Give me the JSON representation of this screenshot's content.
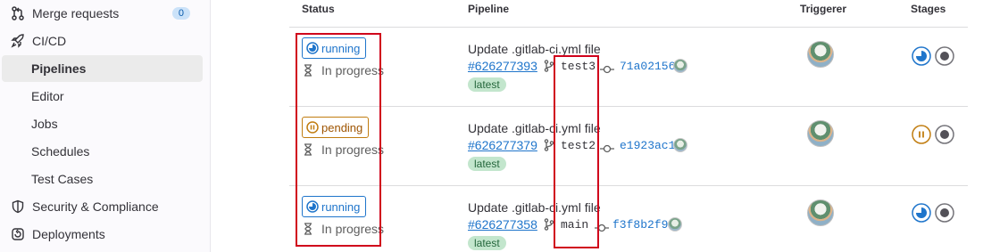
{
  "sidebar": {
    "items": [
      {
        "label": "Merge requests",
        "count": "0"
      },
      {
        "label": "CI/CD"
      },
      {
        "label": "Pipelines"
      },
      {
        "label": "Editor"
      },
      {
        "label": "Jobs"
      },
      {
        "label": "Schedules"
      },
      {
        "label": "Test Cases"
      },
      {
        "label": "Security & Compliance"
      },
      {
        "label": "Deployments"
      }
    ]
  },
  "table": {
    "headers": {
      "status": "Status",
      "pipeline": "Pipeline",
      "triggerer": "Triggerer",
      "stages": "Stages"
    },
    "rows": [
      {
        "status": "running",
        "status_text": "In progress",
        "commit_title": "Update .gitlab-ci.yml file",
        "pipeline_id": "#626277393",
        "branch": "test3",
        "sha": "71a02156",
        "tag": "latest",
        "stage1": "running",
        "stage2": "created"
      },
      {
        "status": "pending",
        "status_text": "In progress",
        "commit_title": "Update .gitlab-ci.yml file",
        "pipeline_id": "#626277379",
        "branch": "test2",
        "sha": "e1923ac1",
        "tag": "latest",
        "stage1": "pending",
        "stage2": "created"
      },
      {
        "status": "running",
        "status_text": "In progress",
        "commit_title": "Update .gitlab-ci.yml file",
        "pipeline_id": "#626277358",
        "branch": "main",
        "sha": "f3f8b2f9",
        "tag": "latest",
        "stage1": "running",
        "stage2": "created"
      }
    ]
  },
  "colors": {
    "running": "#1f75cb",
    "pending": "#c17d10",
    "highlight": "#d0021b",
    "latest_bg": "#c3e6cd"
  }
}
